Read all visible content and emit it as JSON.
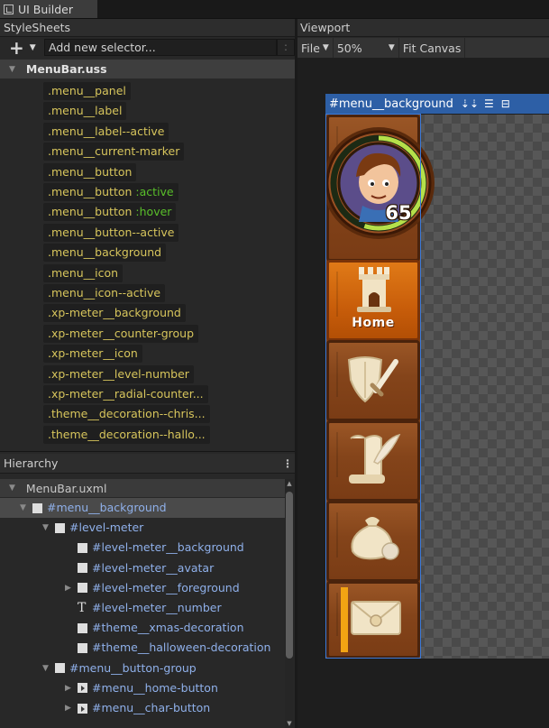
{
  "window": {
    "tab_label": "UI Builder"
  },
  "stylesheets": {
    "header": "StyleSheets",
    "add_label": "+",
    "selector_placeholder": "Add new selector...",
    "selector_suffix": ":",
    "file_name": "MenuBar.uss",
    "selectors": [
      {
        "name": ".menu__panel",
        "pseudo": ""
      },
      {
        "name": ".menu__label",
        "pseudo": ""
      },
      {
        "name": ".menu__label--active",
        "pseudo": ""
      },
      {
        "name": ".menu__current-marker",
        "pseudo": ""
      },
      {
        "name": ".menu__button",
        "pseudo": ""
      },
      {
        "name": ".menu__button",
        "pseudo": ":active"
      },
      {
        "name": ".menu__button",
        "pseudo": ":hover"
      },
      {
        "name": ".menu__button--active",
        "pseudo": ""
      },
      {
        "name": ".menu__background",
        "pseudo": ""
      },
      {
        "name": ".menu__icon",
        "pseudo": ""
      },
      {
        "name": ".menu__icon--active",
        "pseudo": ""
      },
      {
        "name": ".xp-meter__background",
        "pseudo": ""
      },
      {
        "name": ".xp-meter__counter-group",
        "pseudo": ""
      },
      {
        "name": ".xp-meter__icon",
        "pseudo": ""
      },
      {
        "name": ".xp-meter__level-number",
        "pseudo": ""
      },
      {
        "name": ".xp-meter__radial-counter...",
        "pseudo": ""
      },
      {
        "name": ".theme__decoration--chris...",
        "pseudo": ""
      },
      {
        "name": ".theme__decoration--hallo...",
        "pseudo": ""
      }
    ]
  },
  "hierarchy": {
    "header": "Hierarchy",
    "menu_icon": "⋮",
    "file_name": "MenuBar.uxml",
    "items": [
      {
        "label": "#menu__background",
        "depth": 1,
        "expand": "open",
        "icon": "element",
        "selected": true
      },
      {
        "label": "#level-meter",
        "depth": 2,
        "expand": "open",
        "icon": "element"
      },
      {
        "label": "#level-meter__background",
        "depth": 3,
        "expand": "none",
        "icon": "element"
      },
      {
        "label": "#level-meter__avatar",
        "depth": 3,
        "expand": "none",
        "icon": "element"
      },
      {
        "label": "#level-meter__foreground",
        "depth": 3,
        "expand": "closed",
        "icon": "element"
      },
      {
        "label": "#level-meter__number",
        "depth": 3,
        "expand": "none",
        "icon": "text"
      },
      {
        "label": "#theme__xmas-decoration",
        "depth": 3,
        "expand": "none",
        "icon": "element"
      },
      {
        "label": "#theme__halloween-decoration",
        "depth": 3,
        "expand": "none",
        "icon": "element"
      },
      {
        "label": "#menu__button-group",
        "depth": 2,
        "expand": "open",
        "icon": "element"
      },
      {
        "label": "#menu__home-button",
        "depth": 3,
        "expand": "closed",
        "icon": "button"
      },
      {
        "label": "#menu__char-button",
        "depth": 3,
        "expand": "closed",
        "icon": "button"
      }
    ]
  },
  "viewport": {
    "header": "Viewport",
    "file_menu": "File",
    "zoom": "50%",
    "fit_label": "Fit Canvas",
    "canvas_title": "#menu__background",
    "game": {
      "home_label": "Home",
      "level_number": "65",
      "xp_progress": 0.55,
      "buttons": [
        "home",
        "character",
        "inventory",
        "shop",
        "mail"
      ]
    }
  },
  "colors": {
    "selector_text": "#d7c55c",
    "pseudo_text": "#59bf2a",
    "hierarchy_text": "#8fb0ea",
    "selection_blue": "#2d5fa6",
    "home_orange": "#d46b10",
    "xp_green": "#b5e04a"
  }
}
